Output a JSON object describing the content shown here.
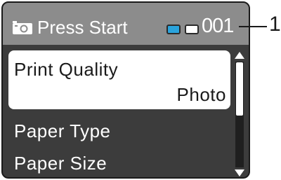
{
  "status_bar": {
    "title": "Press Start",
    "count": "001",
    "mode_icon": "camera-photo-icon",
    "ink_icons": [
      "cyan-ink-cartridge-icon",
      "white-paper-icon"
    ],
    "colors": {
      "bar": "#8c8c8c",
      "ink_cyan": "#2aa3dc"
    }
  },
  "menu": {
    "items": [
      {
        "label": "Print Quality",
        "value": "Photo",
        "selected": true
      },
      {
        "label": "Paper Type"
      },
      {
        "label": "Paper Size"
      }
    ],
    "scroll_position": 0.0
  },
  "callout": {
    "number": "1"
  },
  "colors": {
    "screen_background": "#3c3c3c",
    "selected_background": "#ffffff"
  }
}
